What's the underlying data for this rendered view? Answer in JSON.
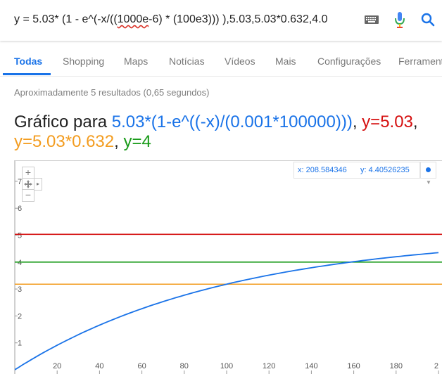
{
  "search": {
    "query_before": "y = 5.03* (1 - e^(-x/((",
    "query_misspelled": "1000e",
    "query_after": "-6) * (100e3))) ),5.03,5.03*0.632,4.0",
    "keyboard_icon": "keyboard-icon",
    "mic_icon": "microphone-icon",
    "search_icon": "search-icon"
  },
  "tabs": [
    {
      "label": "Todas",
      "active": true
    },
    {
      "label": "Shopping"
    },
    {
      "label": "Maps"
    },
    {
      "label": "Notícias"
    },
    {
      "label": "Vídeos"
    },
    {
      "label": "Mais"
    },
    {
      "label": "Configurações"
    },
    {
      "label": "Ferramentas"
    }
  ],
  "stats": "Aproximadamente 5 resultados (0,65 segundos)",
  "graph_title": {
    "prefix": "Gráfico para ",
    "f1": "5.03*(1-e^((-x)/(0.001*100000)))",
    "sep1": ", ",
    "f2": "y=5.03",
    "sep2": ",",
    "f3": "y=5.03*0.632",
    "sep3": ", ",
    "f4": "y=4"
  },
  "coords": {
    "x": "x: 208.584346",
    "y": "y: 4.40526235"
  },
  "controls": {
    "zoom_in": "+",
    "zoom_out": "−",
    "pan_icon": "pan-icon",
    "dropdown_icon": "chevron-down-icon",
    "more": "▸"
  },
  "colors": {
    "blue": "#1a73e8",
    "red": "#d50f0f",
    "orange": "#f39c1f",
    "green": "#189a18"
  },
  "chart_data": {
    "type": "line",
    "xlim": [
      0,
      200
    ],
    "ylim": [
      0,
      7
    ],
    "x_ticks": [
      "20",
      "40",
      "60",
      "80",
      "100",
      "120",
      "140",
      "160",
      "180",
      "2"
    ],
    "y_ticks": [
      "1",
      "2",
      "3",
      "4",
      "5",
      "6",
      "7"
    ],
    "grid": false,
    "series": [
      {
        "name": "5.03*(1-e^((-x)/(0.001*100000)))",
        "color": "#1a73e8",
        "a": 5.03,
        "tau": 100
      },
      {
        "name": "y=5.03",
        "color": "#d50f0f",
        "value": 5.03
      },
      {
        "name": "y=5.03*0.632",
        "color": "#f39c1f",
        "value": 3.179
      },
      {
        "name": "y=4",
        "color": "#189a18",
        "value": 4
      }
    ]
  }
}
